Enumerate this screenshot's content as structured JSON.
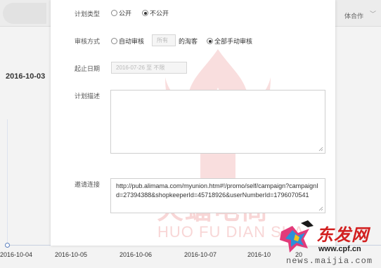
{
  "background": {
    "top_right_text": "体合作",
    "left_date": "2016-10-03",
    "axis_dates": [
      "2016-10-04",
      "2016-10-05",
      "2016-10-06",
      "2016-10-07",
      "2016-10",
      "20"
    ]
  },
  "form": {
    "plan_type": {
      "label": "计划类型",
      "options": [
        {
          "label": "公开",
          "checked": false
        },
        {
          "label": "不公开",
          "checked": true
        }
      ]
    },
    "review": {
      "label": "审核方式",
      "auto_label": "自动审核",
      "auto_select": "所有",
      "auto_suffix": "的淘客",
      "manual_label": "全部手动审核",
      "auto_checked": false,
      "manual_checked": true
    },
    "start_date": {
      "label": "起止日期",
      "value": "2016-07-26 至 不限"
    },
    "description": {
      "label": "计划描述",
      "value": ""
    },
    "invite": {
      "label": "邀请连接",
      "value": "http://pub.alimama.com/myunion.htm#!/promo/self/campaign?campaignId=27394388&shopkeeperId=45718926&userNumberId=1796070541"
    }
  },
  "watermark": {
    "title": "火蝠电商",
    "subtitle": "HUO FU DIAN SHA"
  },
  "corner_logo": {
    "chinese": "东发网",
    "url1": "www.cpf.cn",
    "url2": "news.maijia.com"
  },
  "colors": {
    "watermark": "#e04646",
    "logo_red": "#d21f1f"
  }
}
